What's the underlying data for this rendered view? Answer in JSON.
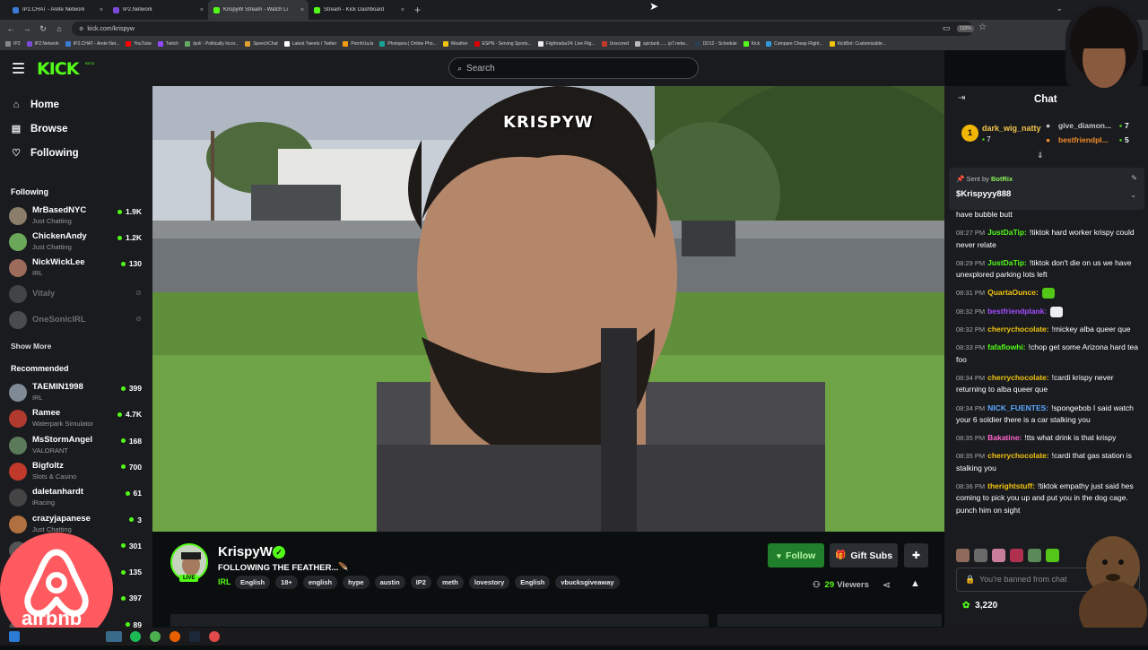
{
  "browser": {
    "tabs": [
      {
        "title": "IP2.CHAT - Arete Network",
        "fav": "#3a7bd5",
        "active": false
      },
      {
        "title": "IP2.Network",
        "fav": "#7b4ad6",
        "active": false
      },
      {
        "title": "KrispyW Stream - Watch Li",
        "fav": "#53fc18",
        "active": true
      },
      {
        "title": "Stream - Kick Dashboard",
        "fav": "#53fc18",
        "active": false
      }
    ],
    "url": "kick.com/krispyw",
    "zoom": "133%",
    "bookmarks": [
      {
        "label": "IP2",
        "c": "#888"
      },
      {
        "label": "IP2.Network",
        "c": "#7b4ad6"
      },
      {
        "label": "IP2.CHAT - Arete Net...",
        "c": "#3a7bd5"
      },
      {
        "label": "YouTube",
        "c": "#ff0000"
      },
      {
        "label": "Twitch",
        "c": "#9146ff"
      },
      {
        "label": "/pol/ - Politically Incor...",
        "c": "#66aa66"
      },
      {
        "label": "SpeechChat",
        "c": "#e0a030"
      },
      {
        "label": "Latest Tweets / Twitter",
        "c": "#ffffff"
      },
      {
        "label": "Pornhl.la.la",
        "c": "#f39c12"
      },
      {
        "label": "Photopea | Online Pho...",
        "c": "#18a497"
      },
      {
        "label": "Weather",
        "c": "#f1c40f"
      },
      {
        "label": "ESPN - Serving Sports...",
        "c": "#d00"
      },
      {
        "label": "Flightradar24: Live Flig...",
        "c": "#eee"
      },
      {
        "label": "Unscored",
        "c": "#c0392b"
      },
      {
        "label": "spictank ..... ip7.netw...",
        "c": "#bbb"
      },
      {
        "label": "DD12 - Schedule",
        "c": "#2c3e50"
      },
      {
        "label": "Kick",
        "c": "#53fc18"
      },
      {
        "label": "Compare Cheap Flight...",
        "c": "#3498db"
      },
      {
        "label": "KickBot: Customizable...",
        "c": "#f1c40f"
      }
    ]
  },
  "header": {
    "logo": "KICK",
    "beta": "BETA",
    "search_placeholder": "Search"
  },
  "nav": {
    "home": "Home",
    "browse": "Browse",
    "following": "Following"
  },
  "sidebar": {
    "following_title": "Following",
    "following": [
      {
        "name": "MrBasedNYC",
        "cat": "Just Chatting",
        "viewers": "1.9K",
        "c": "#8a7d6a",
        "live": true
      },
      {
        "name": "ChickenAndy",
        "cat": "Just Chatting",
        "viewers": "1.2K",
        "c": "#6ba85a",
        "live": true
      },
      {
        "name": "NickWickLee",
        "cat": "IRL",
        "viewers": "130",
        "c": "#9c6b5a",
        "live": true
      },
      {
        "name": "Vitaly",
        "cat": "",
        "viewers": "",
        "c": "#777",
        "live": false
      },
      {
        "name": "OneSonicIRL",
        "cat": "",
        "viewers": "",
        "c": "#888",
        "live": false
      }
    ],
    "show_more": "Show More",
    "recommended_title": "Recommended",
    "recommended": [
      {
        "name": "TAEMIN1998",
        "cat": "IRL",
        "viewers": "399",
        "c": "#7f8a96"
      },
      {
        "name": "Ramee",
        "cat": "Waterpark Simulator",
        "viewers": "4.7K",
        "c": "#b03a2e"
      },
      {
        "name": "MsStormAngel",
        "cat": "VALORANT",
        "viewers": "168",
        "c": "#5a7a5a"
      },
      {
        "name": "Bigfoltz",
        "cat": "Slots & Casino",
        "viewers": "700",
        "c": "#c0392b"
      },
      {
        "name": "daletanhardt",
        "cat": "iRacing",
        "viewers": "61",
        "c": "#444"
      },
      {
        "name": "crazyjapanese",
        "cat": "Just Chatting",
        "viewers": "3",
        "c": "#b07040"
      },
      {
        "name": "",
        "cat": "",
        "viewers": "301",
        "c": "#555"
      },
      {
        "name": "",
        "cat": "",
        "viewers": "135",
        "c": "#555"
      },
      {
        "name": "",
        "cat": "",
        "viewers": "397",
        "c": "#555"
      },
      {
        "name": "",
        "cat": "",
        "viewers": "89",
        "c": "#555"
      }
    ]
  },
  "video": {
    "overlay_name": "KRISPYW"
  },
  "stream": {
    "name": "KrispyW",
    "live": "LIVE",
    "title": "FOLLOWING THE FEATHER...",
    "category": "IRL",
    "tags": [
      "English",
      "18+",
      "english",
      "hype",
      "austin",
      "IP2",
      "meth",
      "lovestory",
      "English",
      "vbucksgiveaway"
    ],
    "follow": "Follow",
    "gift_subs": "Gift Subs",
    "viewers_count": "29",
    "viewers_label": "Viewers"
  },
  "chat": {
    "title": "Chat",
    "top_gifter": {
      "rank": "1",
      "name": "dark_wig_natty",
      "count": "7"
    },
    "gifters": [
      {
        "name": "give_diamon...",
        "count": "7",
        "c": "#c8c8c8"
      },
      {
        "name": "bestfriendpl...",
        "count": "5",
        "c": "#f28c28"
      }
    ],
    "pinned": {
      "sent_by": "Sent by",
      "bot": "BotRix",
      "message": "$Krispyyy888"
    },
    "messages": [
      {
        "time": "",
        "user": "",
        "uc": "#fff",
        "text": "have bubble butt"
      },
      {
        "time": "08:27 PM",
        "user": "JustDaTip:",
        "uc": "#53fc18",
        "text": "!tiktok hard worker krispy could never relate"
      },
      {
        "time": "08:29 PM",
        "user": "JustDaTip:",
        "uc": "#53fc18",
        "text": "!tiktok don't die on us we have unexplored parking lots left"
      },
      {
        "time": "08:31 PM",
        "user": "QuartaOunce:",
        "uc": "#f1c40f",
        "text": ""
      },
      {
        "time": "08:32 PM",
        "user": "bestfriendplank:",
        "uc": "#a64dff",
        "text": ""
      },
      {
        "time": "08:32 PM",
        "user": "cherrychocolate:",
        "uc": "#f1c40f",
        "text": "!mickey alba queer que"
      },
      {
        "time": "08:33 PM",
        "user": "fafaflowhi:",
        "uc": "#53fc18",
        "text": "!chop get some Arizona hard tea foo"
      },
      {
        "time": "08:34 PM",
        "user": "cherrychocolate:",
        "uc": "#f1c40f",
        "text": "!cardi krispy never returning to alba queer que"
      },
      {
        "time": "08:34 PM",
        "user": "NICK_FUENTES:",
        "uc": "#5da9ff",
        "text": "!spongebob I said watch your 6 soldier there is a car stalking you"
      },
      {
        "time": "08:35 PM",
        "user": "Bakatine:",
        "uc": "#ff66cc",
        "text": "!tts what drink is that krispy"
      },
      {
        "time": "08:35 PM",
        "user": "cherrychocolate:",
        "uc": "#f1c40f",
        "text": "!cardi that gas station is stalking you"
      },
      {
        "time": "08:36 PM",
        "user": "therightstuff:",
        "uc": "#f1c40f",
        "text": "!tiktok empathy just said hes coming to pick you up and put you in the dog cage. punch him on sight"
      }
    ],
    "banned": "You're banned from chat",
    "points": "3,220"
  },
  "overlays": {
    "airbnb": "airbnb"
  },
  "colors": {
    "kick_green": "#53fc18",
    "bg": "#0b0e0f",
    "panel": "#191b1f"
  }
}
